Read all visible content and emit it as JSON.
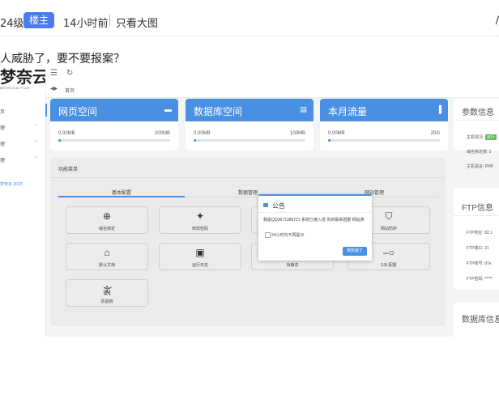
{
  "post": {
    "level": "24级)",
    "badge": "楼主",
    "time": "14小时前",
    "only_op": "只看大图",
    "edge_mark": "∕",
    "text": "人威胁了，要不要报案？"
  },
  "screenshot": {
    "logo": {
      "main": "梦奈云",
      "sub": "MENGNAIYUN"
    },
    "topbar": {
      "menu_icon": "☰",
      "refresh_icon": "↻"
    },
    "breadcrumb": {
      "icon": "◀▶",
      "home": "首页"
    },
    "sidebar": {
      "items": [
        {
          "label": "页",
          "chevron": ""
        },
        {
          "label": "理",
          "chevron": "›"
        },
        {
          "label": "理",
          "chevron": "›"
        },
        {
          "label": "理",
          "chevron": "›"
        }
      ],
      "footer": "梦奈云 2023"
    },
    "cards": [
      {
        "title": "网页空间",
        "icon": "▬",
        "min": "0.00MB",
        "max": "200MB",
        "fill": 0.02
      },
      {
        "title": "数据库空间",
        "icon": "▤",
        "min": "0.00MB",
        "max": "100MB",
        "fill": 0.02
      },
      {
        "title": "本月流量",
        "icon": "▐",
        "min": "0.00MB",
        "max": "20G",
        "fill": 0.02
      }
    ],
    "func_panel": {
      "title": "功能菜单",
      "tabs": [
        "基本配置",
        "数据管理",
        "网站管理"
      ],
      "buttons": [
        {
          "label": "域名绑定",
          "icon": "⊕"
        },
        {
          "label": "修改密码",
          "icon": "✦"
        },
        {
          "label": "",
          "icon": ""
        },
        {
          "label": "网站防护",
          "icon": "⛉"
        },
        {
          "label": "默认文档",
          "icon": "⌂"
        },
        {
          "label": "运行日志",
          "icon": "▣"
        },
        {
          "label": "伪静态",
          "icon": ""
        },
        {
          "label": "SSL配置",
          "icon": "‒○"
        },
        {
          "label": "防盗链",
          "icon": "ༀ"
        }
      ]
    },
    "modal": {
      "title": "公告",
      "body": "我是QQ3671386721 系统已被入侵 你的联系困郡 网站表",
      "checkbox_label": "24小时内不再提示",
      "confirm": "我知道了"
    },
    "right_panels": {
      "params": {
        "title": "参数信息",
        "rows": [
          {
            "label": "主机情况:",
            "value": "运行"
          },
          {
            "label": "域名绑定数:",
            "value": "5"
          },
          {
            "label": "主机语言:",
            "value": "PHP"
          }
        ]
      },
      "ftp": {
        "title": "FTP信息",
        "rows": [
          {
            "label": "FTP地址:",
            "value": "82.1"
          },
          {
            "label": "FTP端口:",
            "value": "21"
          },
          {
            "label": "FTP账号:",
            "value": "d7e"
          },
          {
            "label": "FTP密码:",
            "value": "*****"
          }
        ]
      },
      "db": {
        "title": "数据库信息"
      }
    },
    "colors": {
      "accent": "#4a90e2",
      "badge": "#4a7cf0",
      "status_ok": "#5cb85c"
    }
  }
}
